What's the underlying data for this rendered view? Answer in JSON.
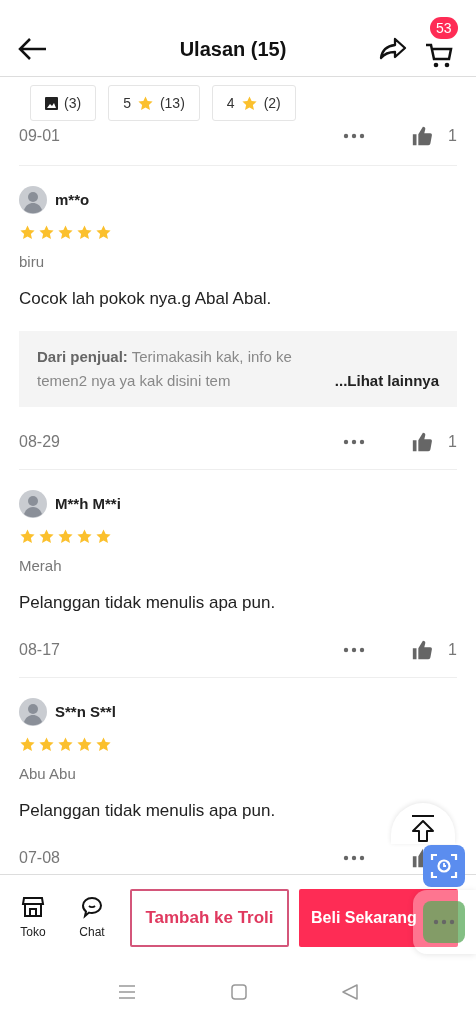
{
  "header": {
    "title": "Ulasan (15)",
    "cart_count": "53"
  },
  "filters": [
    {
      "kind": "photo",
      "count": "(3)"
    },
    {
      "kind": "rating",
      "rating": "5",
      "count": "(13)"
    },
    {
      "kind": "rating",
      "rating": "4",
      "count": "(2)"
    }
  ],
  "top_partial": {
    "date": "09-01",
    "likes": "1"
  },
  "reviews": [
    {
      "user": "m**o",
      "stars": 5,
      "variant": "biru",
      "text": "Cocok lah pokok nya.g Abal Abal.",
      "reply": {
        "text": "**Dari penjual:** Terimakasih kak, info ke temen2 nya ya kak disini tem",
        "more": "...Lihat lainnya"
      },
      "date": "08-29",
      "likes": "1"
    },
    {
      "user": "M**h M**i",
      "stars": 5,
      "variant": "Merah",
      "text": "Pelanggan tidak menulis apa pun.",
      "date": "08-17",
      "likes": "1"
    },
    {
      "user": "S**n S**l",
      "stars": 5,
      "variant": "Abu Abu",
      "text": "Pelanggan tidak menulis apa pun.",
      "date": "07-08"
    }
  ],
  "bottom_bar": {
    "store": "Toko",
    "chat": "Chat",
    "add_to_cart": "Tambah ke Troli",
    "buy_now": "Beli Sekarang"
  }
}
